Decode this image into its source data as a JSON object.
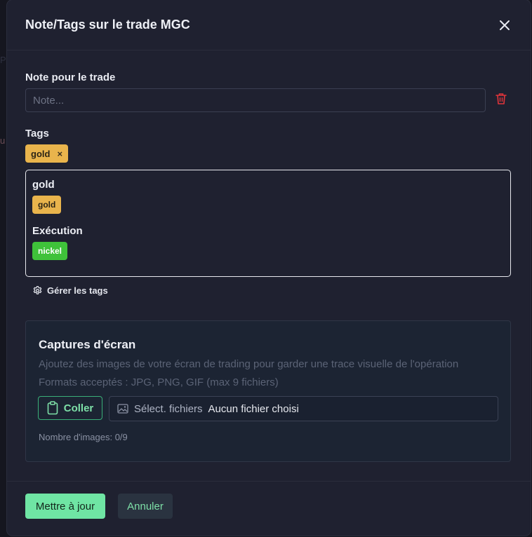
{
  "modal": {
    "title": "Note/Tags sur le trade MGC"
  },
  "note": {
    "label": "Note pour le trade",
    "placeholder": "Note...",
    "value": ""
  },
  "tags": {
    "label": "Tags",
    "selected": [
      {
        "label": "gold",
        "remove": "×"
      }
    ],
    "groups": [
      {
        "title": "gold",
        "tag": "gold",
        "color": "#e9b44c"
      },
      {
        "title": "Exécution",
        "tag": "nickel",
        "color": "#3fc23a"
      }
    ],
    "manage_label": "Gérer les tags"
  },
  "screenshots": {
    "title": "Captures d'écran",
    "description": "Ajoutez des images de votre écran de trading pour garder une trace visuelle de l'opération",
    "formats": "Formats acceptés : JPG, PNG, GIF (max 9 fichiers)",
    "paste_label": "Coller",
    "select_label": "Sélect. fichiers",
    "no_file_label": "Aucun fichier choisi",
    "count_label": "Nombre d'images: 0/9"
  },
  "footer": {
    "update_label": "Mettre à jour",
    "cancel_label": "Annuler"
  },
  "colors": {
    "accent": "#6fe5a4",
    "danger": "#e0343a",
    "tag_gold": "#e9b44c",
    "tag_green": "#3fc23a"
  }
}
